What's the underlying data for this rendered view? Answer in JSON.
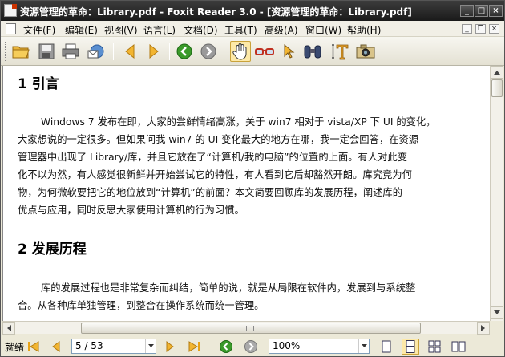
{
  "window": {
    "title": "资源管理的革命：Library.pdf - Foxit Reader 3.0 - [资源管理的革命：Library.pdf]",
    "controls": {
      "minimize": "_",
      "maximize": "□",
      "close": "×"
    }
  },
  "menu": [
    {
      "label": "文件(F)"
    },
    {
      "label": "编辑(E)"
    },
    {
      "label": "视图(V)"
    },
    {
      "label": "语言(L)"
    },
    {
      "label": "文档(D)"
    },
    {
      "label": "工具(T)"
    },
    {
      "label": "高级(A)"
    },
    {
      "label": "窗口(W)"
    },
    {
      "label": "帮助(H)"
    }
  ],
  "mdi_controls": {
    "minimize": "_",
    "restore": "❐",
    "close": "×"
  },
  "toolbar": {
    "icons": [
      "open-folder-icon",
      "save-icon",
      "print-icon",
      "email-icon",
      "previous-page-icon",
      "next-page-icon",
      "back-icon",
      "forward-icon",
      "hand-tool-icon",
      "glasses-icon",
      "select-arrow-icon",
      "find-binoculars-icon",
      "text-select-icon",
      "snapshot-camera-icon"
    ]
  },
  "document": {
    "section1": {
      "heading": "1 引言",
      "lines": [
        "Windows 7 发布在即，大家的尝鲜情绪高涨，关于 win7 相对于 vista/XP 下 UI 的变化，",
        "大家想说的一定很多。但如果问我 win7 的 UI 变化最大的地方在哪，我一定会回答，在资源",
        "管理器中出现了 Library/库，并且它放在了“计算机/我的电脑”的位置的上面。有人对此变",
        "化不以为然，有人感觉很新鲜并开始尝试它的特性，有人看到它后却豁然开朗。库究竟为何",
        "物，为何微软要把它的地位放到“计算机”的前面？本文简要回顾库的发展历程，阐述库的",
        "优点与应用，同时反思大家使用计算机的行为习惯。"
      ]
    },
    "section2": {
      "heading": "2 发展历程",
      "lines": [
        "库的发展过程也是非常复杂而纠结，简单的说，就是从局限在软件内，发展到与系统整",
        "合。从各种库单独管理，到整合在操作系统而统一管理。"
      ]
    }
  },
  "status": {
    "text": "就绪",
    "page_indicator": "5 / 53",
    "zoom": "100%"
  },
  "colors": {
    "titlebar": "#1a1a1a",
    "accent_green": "#3a9a2a",
    "arrow_orange": "#e8a317"
  }
}
